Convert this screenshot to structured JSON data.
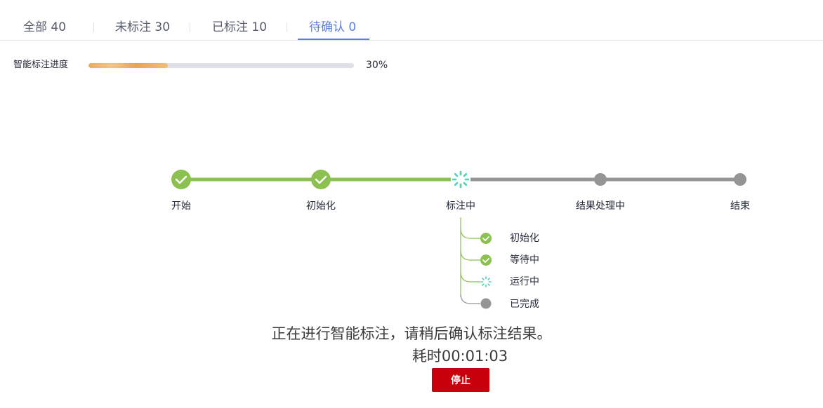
{
  "tabs": [
    {
      "label": "全部 40",
      "active": false
    },
    {
      "label": "未标注 30",
      "active": false
    },
    {
      "label": "已标注 10",
      "active": false
    },
    {
      "label": "待确认 0",
      "active": true
    }
  ],
  "progress": {
    "label": "智能标注进度",
    "percent": 30,
    "display": "30%"
  },
  "steps": [
    {
      "label": "开始",
      "status": "done"
    },
    {
      "label": "初始化",
      "status": "done"
    },
    {
      "label": "标注中",
      "status": "running"
    },
    {
      "label": "结果处理中",
      "status": "pending"
    },
    {
      "label": "结束",
      "status": "pending"
    }
  ],
  "sub_steps": [
    {
      "label": "初始化",
      "status": "done"
    },
    {
      "label": "等待中",
      "status": "done"
    },
    {
      "label": "运行中",
      "status": "running"
    },
    {
      "label": "已完成",
      "status": "pending"
    }
  ],
  "message": "正在进行智能标注，请稍后确认标注结果。",
  "elapsed": "耗时00:01:03",
  "stop_button": "停止",
  "colors": {
    "done": "#8cc152",
    "pending": "#959595",
    "running": "#4dd4b7",
    "active_tab": "#5e7ce0",
    "danger": "#c7000b"
  }
}
